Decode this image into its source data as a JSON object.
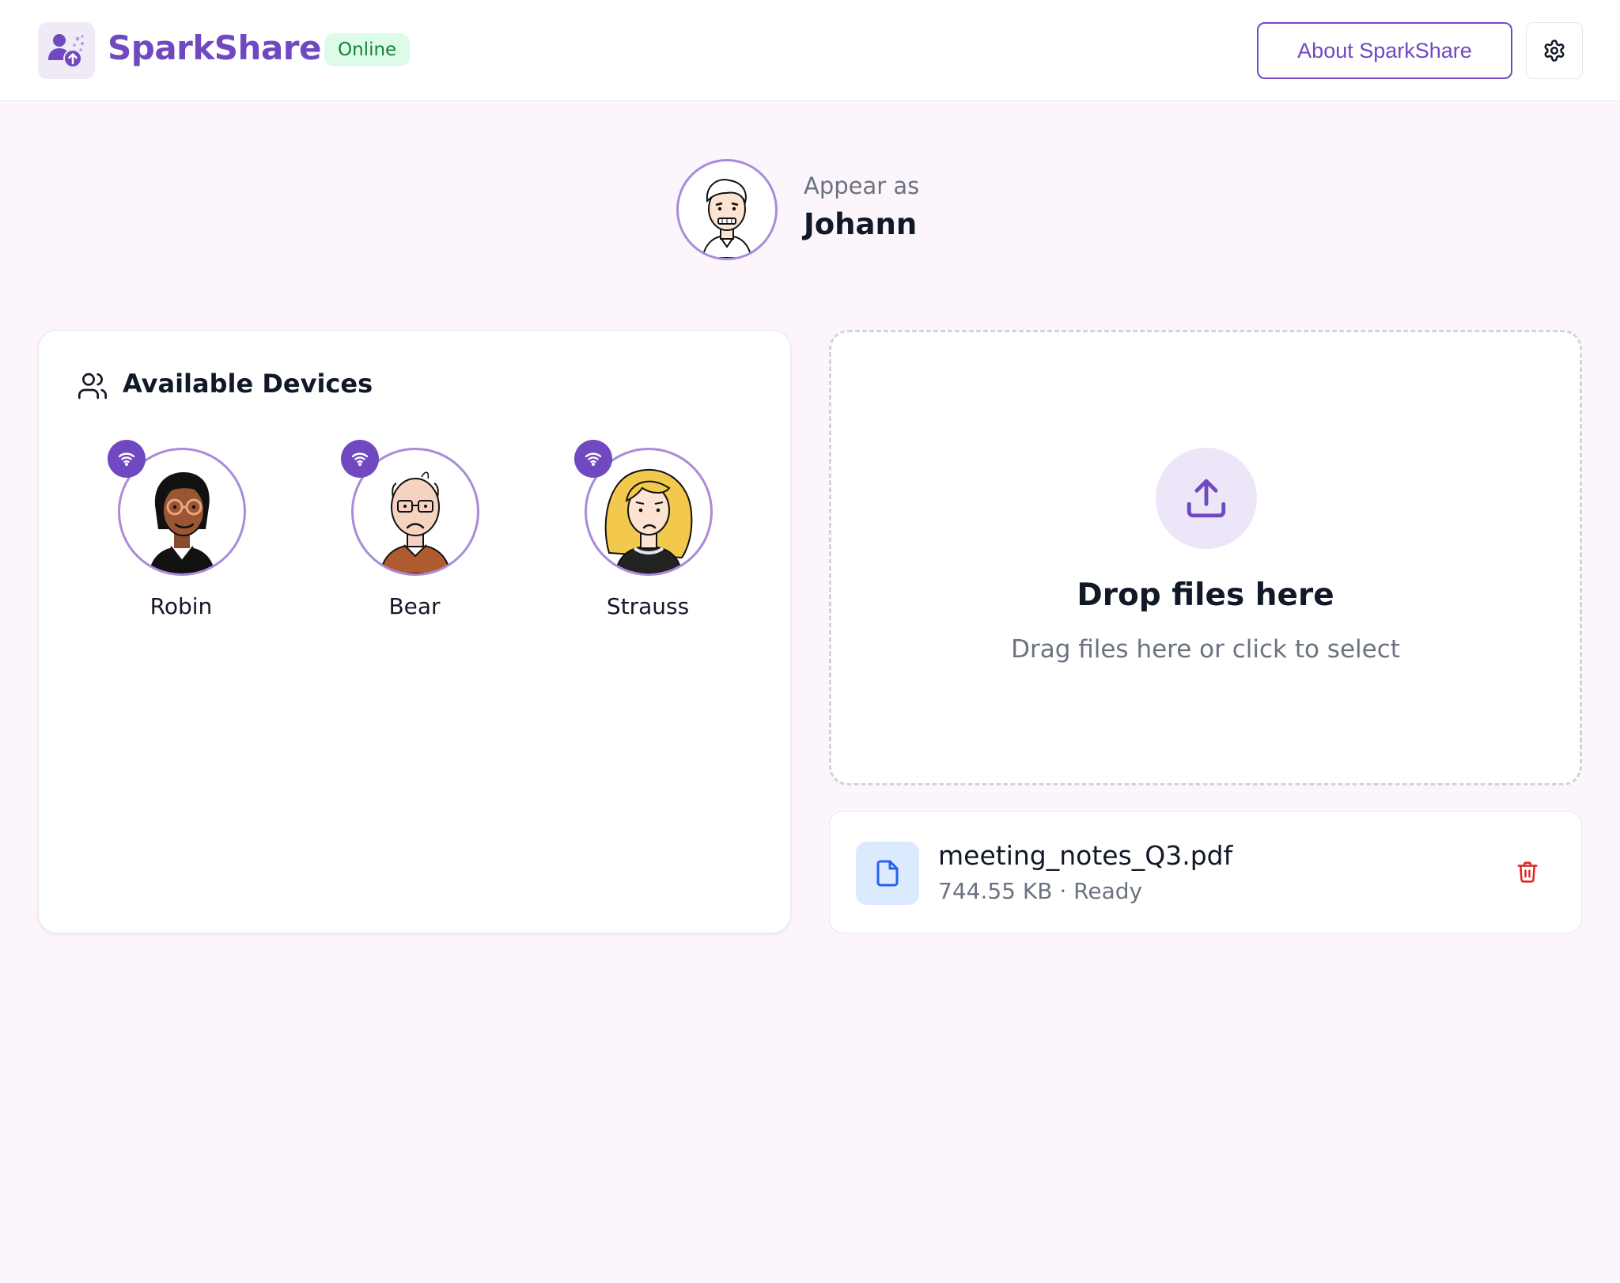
{
  "app": {
    "brand": "SparkShare",
    "status": "Online",
    "about_label": "About SparkShare",
    "icons": {
      "logo": "user-upload-icon",
      "settings": "gear-icon"
    },
    "colors": {
      "accent": "#7048c0",
      "status_bg": "#dcfce7",
      "status_text": "#15803d",
      "danger": "#dc2626"
    }
  },
  "profile": {
    "label": "Appear as",
    "name": "Johann"
  },
  "devices": {
    "title": "Available Devices",
    "title_icon": "users-icon",
    "items": [
      {
        "name": "Robin",
        "status_icon": "wifi-icon"
      },
      {
        "name": "Bear",
        "status_icon": "wifi-icon"
      },
      {
        "name": "Strauss",
        "status_icon": "wifi-icon"
      }
    ]
  },
  "dropzone": {
    "icon": "upload-icon",
    "title": "Drop files here",
    "subtitle": "Drag files here or click to select"
  },
  "files": [
    {
      "name": "meeting_notes_Q3.pdf",
      "meta": "744.55 KB · Ready",
      "icon": "file-icon",
      "delete_icon": "trash-icon"
    }
  ]
}
